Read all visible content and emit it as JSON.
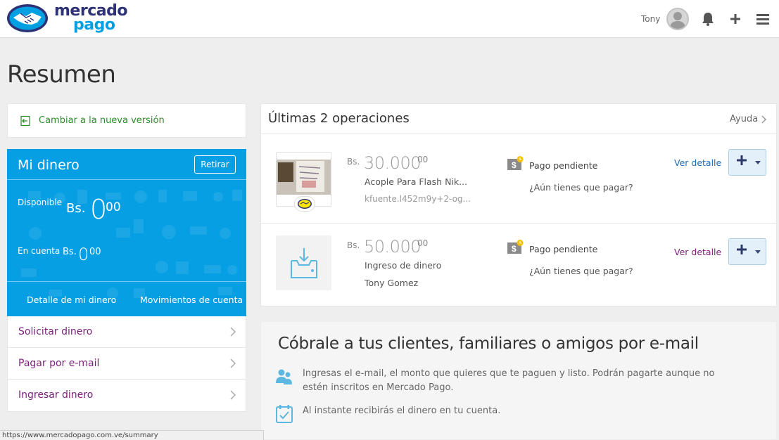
{
  "header": {
    "logo_line1": "mercado",
    "logo_line2": "pago",
    "user_name": "Tony",
    "icons": [
      "avatar",
      "bell-icon",
      "plus-icon",
      "menu-icon"
    ]
  },
  "page_title": "Resumen",
  "switch_version": {
    "label": "Cambiar a la nueva versión",
    "icon": "switch-icon"
  },
  "money": {
    "title": "Mi dinero",
    "withdraw_label": "Retirar",
    "available_label": "Disponible",
    "available_currency": "Bs.",
    "available_int": "0",
    "available_dec": "00",
    "account_label": "En cuenta",
    "account_currency": "Bs.",
    "account_int": "0",
    "account_dec": "00",
    "detail_link": "Detalle de mi dinero",
    "movements_link": "Movimientos de cuenta",
    "accent": "#079fe3"
  },
  "actions": [
    {
      "label": "Solicitar dinero"
    },
    {
      "label": "Pagar por e-mail"
    },
    {
      "label": "Ingresar dinero"
    }
  ],
  "operations": {
    "title": "Últimas 2 operaciones",
    "help": "Ayuda",
    "items": [
      {
        "currency": "Bs.",
        "amount": "30.000",
        "amount_dec": "00",
        "line1": "Acople Para Flash Nik...",
        "line2": "kfuente.l452m9y+2-og...",
        "status": "Pago pendiente",
        "pay_question": "¿Aún tienes que pagar?",
        "detail": "Ver detalle"
      },
      {
        "currency": "Bs.",
        "amount": "50.000",
        "amount_dec": "00",
        "line1": "Ingreso de dinero",
        "line2": "Tony Gomez",
        "status": "Pago pendiente",
        "pay_question": "¿Aún tienes que pagar?",
        "detail": "Ver detalle"
      }
    ]
  },
  "promo": {
    "title": "Cóbrale a tus clientes, familiares o amigos por e-mail",
    "point1": "Ingresas el e-mail, el monto que quieres que te paguen y listo. Podrán pagarte aunque no estén inscritos en Mercado Pago.",
    "point2": "Al instante recibirás el dinero en tu cuenta."
  },
  "statusbar_url": "https://www.mercadopago.com.ve/summary",
  "colors": {
    "link_purple": "#7b1f7b",
    "detail_blue": "#1f6db3",
    "detail_purple": "#7b1f7b",
    "green": "#2b8a2b"
  }
}
